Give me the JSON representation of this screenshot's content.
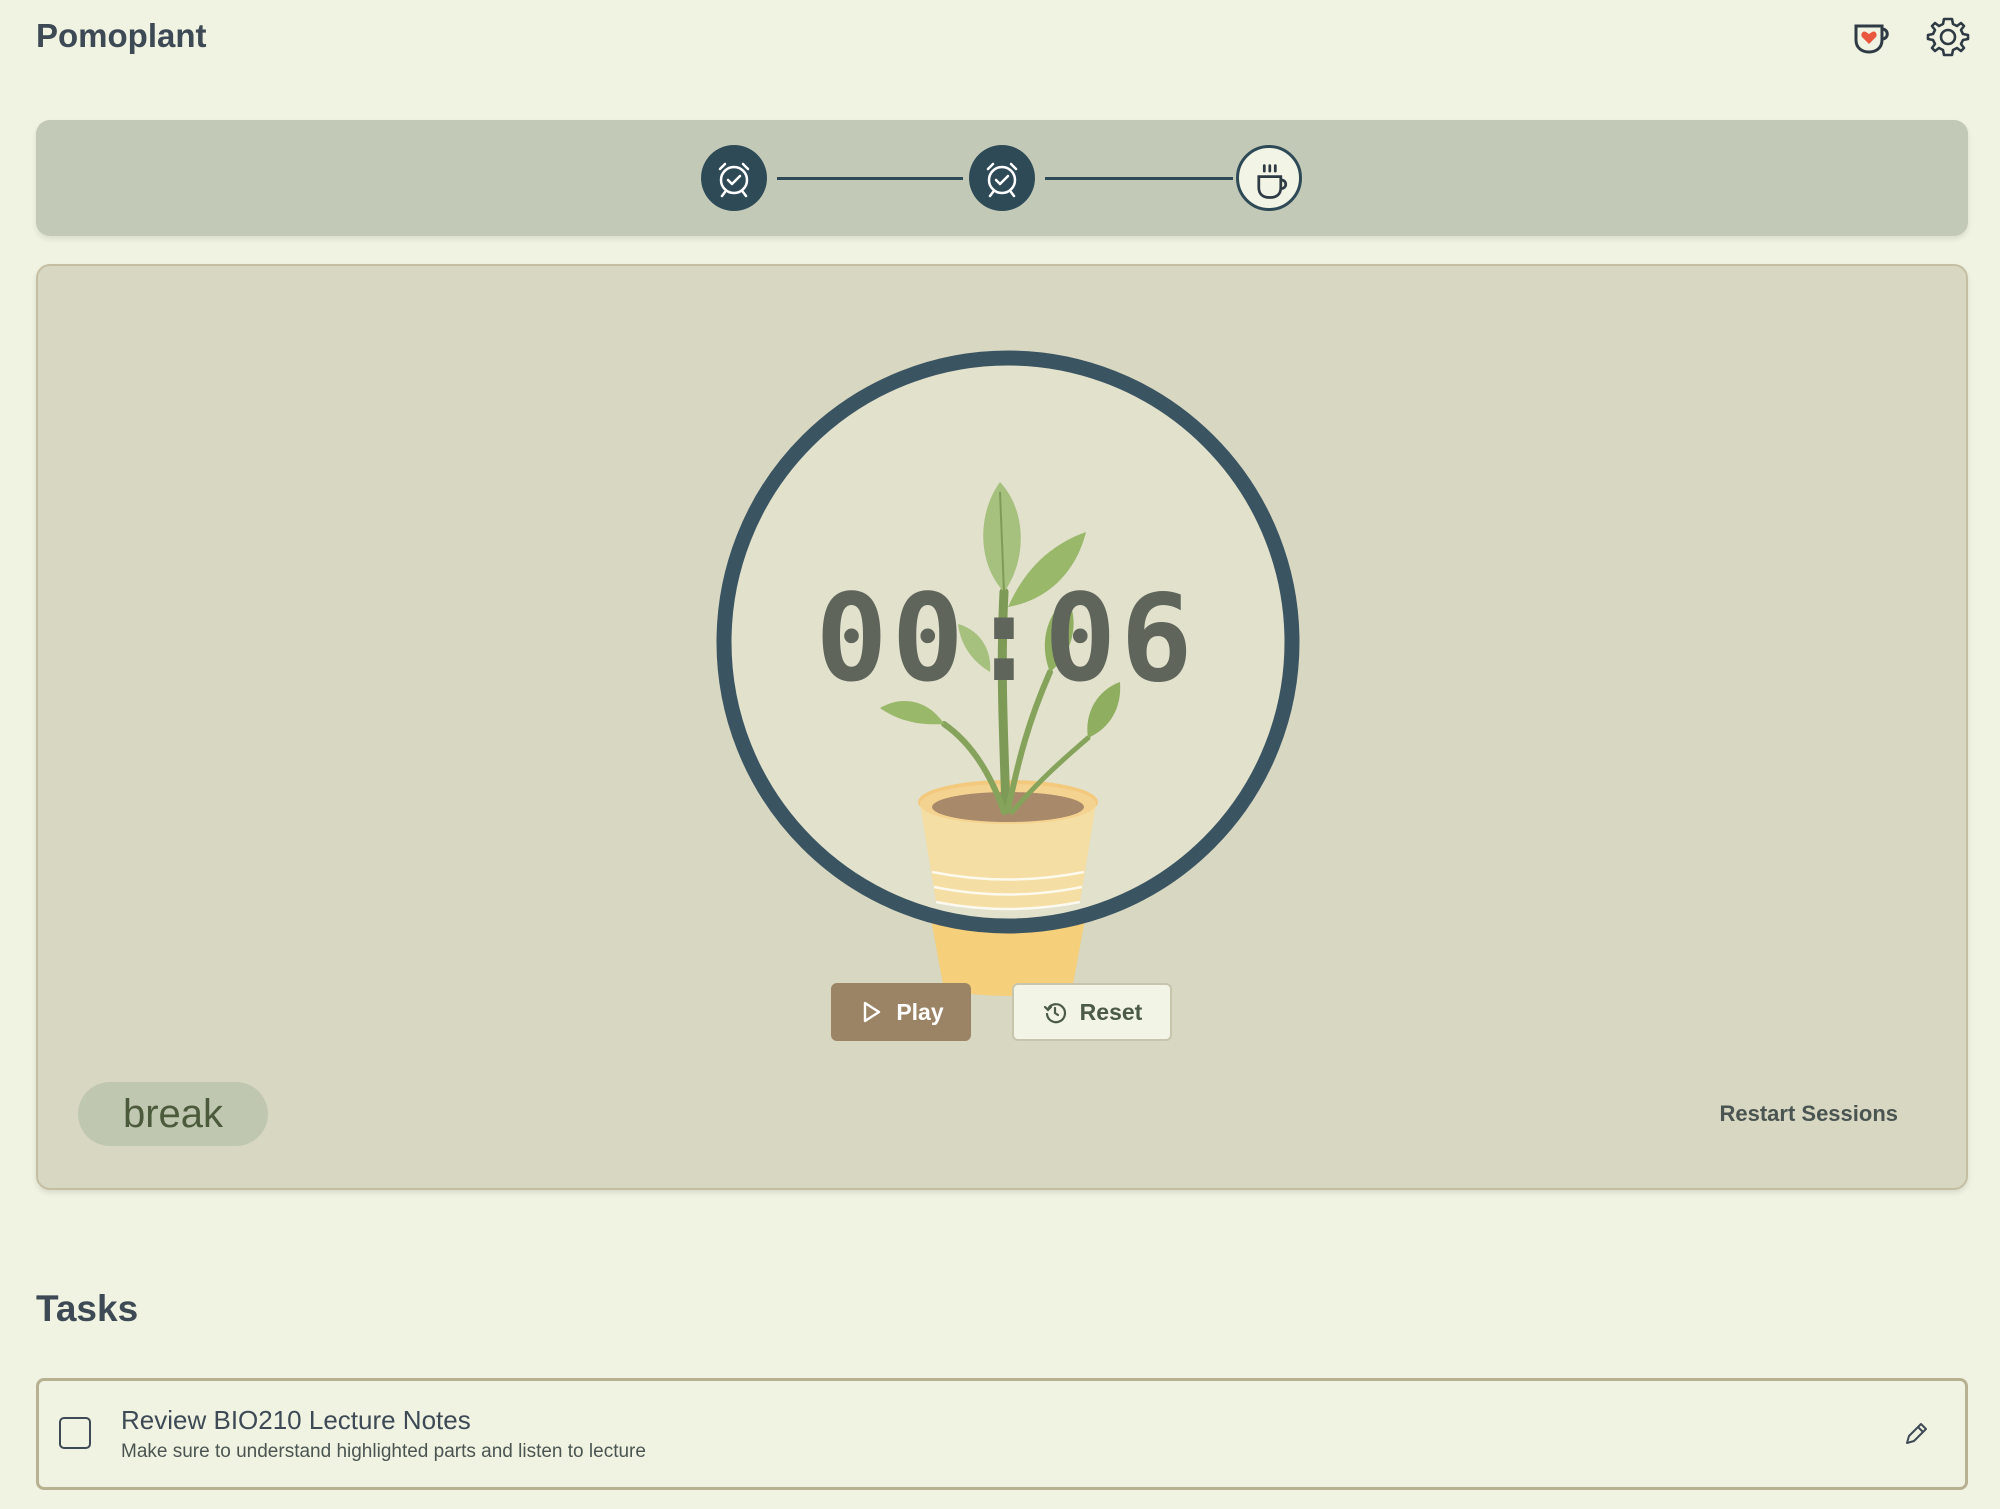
{
  "app": {
    "title": "Pomoplant",
    "icons": {
      "support": "heart-cup-icon",
      "settings": "gear-icon"
    }
  },
  "stepper": {
    "steps": [
      {
        "icon": "alarm-clock-check-icon",
        "state": "completed"
      },
      {
        "icon": "alarm-clock-check-icon",
        "state": "completed"
      },
      {
        "icon": "coffee-cup-icon",
        "state": "current"
      }
    ]
  },
  "timer": {
    "display": "00:06",
    "mode": "break",
    "controls": {
      "play_label": "Play",
      "reset_label": "Reset"
    },
    "restart_label": "Restart Sessions"
  },
  "tasks": {
    "heading": "Tasks",
    "items": [
      {
        "title": "Review BIO210 Lecture Notes",
        "description": "Make sure to understand highlighted parts and listen to lecture",
        "checked": false
      }
    ]
  },
  "colors": {
    "background": "#f1f3e2",
    "accent_dark": "#2e4a57",
    "play_button": "#9b8465",
    "card": "#d8d7c2",
    "stepper_bar": "#c3c9b7"
  }
}
